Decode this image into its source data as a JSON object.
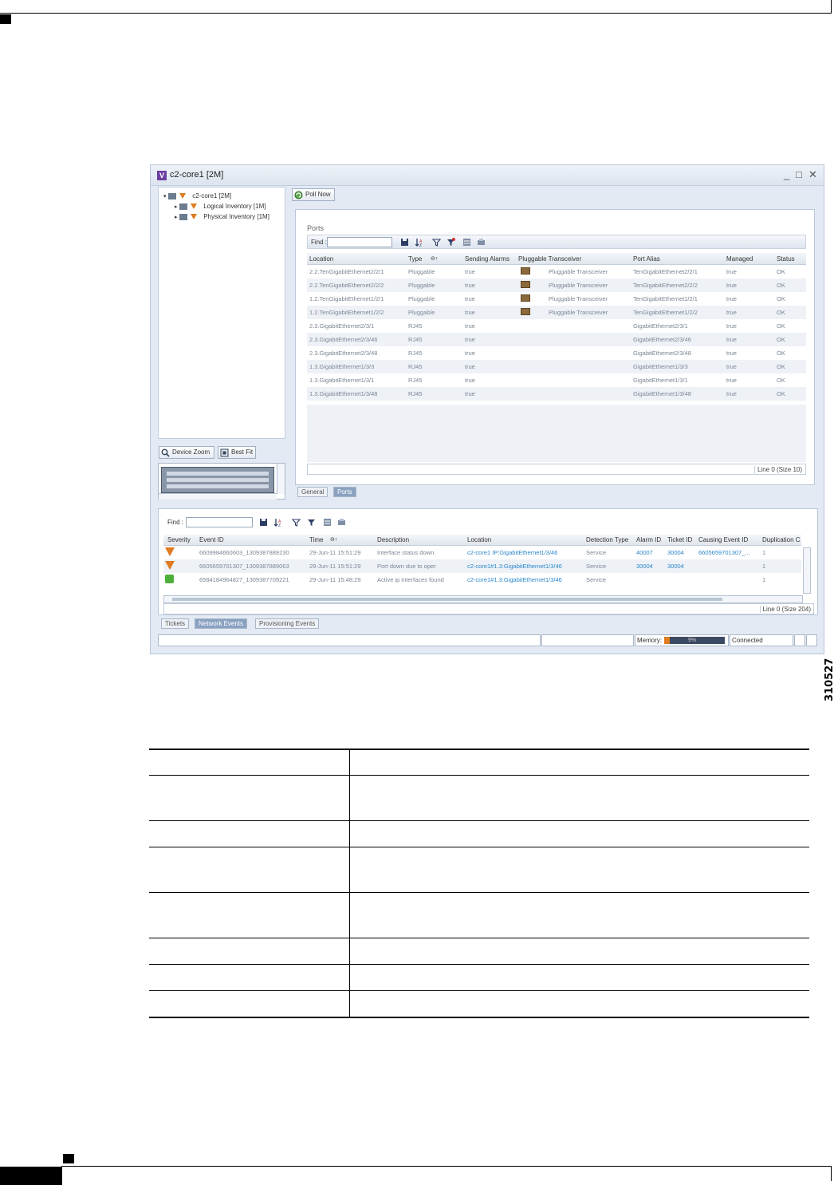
{
  "figure": {
    "id": "310527"
  },
  "window": {
    "title": "c2-core1 [2M]",
    "app_icon": "V",
    "controls": [
      "_",
      "□",
      "✕"
    ]
  },
  "tree": {
    "root": "c2-core1 [2M]",
    "children": [
      "Logical Inventory [1M]",
      "Physical Inventory [1M]"
    ]
  },
  "zoom": {
    "device_zoom_label": "Device Zoom",
    "best_fit_label": "Best Fit"
  },
  "poll_now_label": "Poll Now",
  "ports": {
    "title": "Ports",
    "find_label": "Find :",
    "find_value": "",
    "columns": [
      "Location",
      "Type",
      "Sending Alarms",
      "Pluggable Transceiver",
      "Port Alias",
      "Managed",
      "Status"
    ],
    "rows": [
      {
        "location": "2.2.TenGigabitEthernet2/2/1",
        "type": "Pluggable",
        "sending": "true",
        "pluggable": "Pluggable Transceiver",
        "alias": "TenGigabitEthernet2/2/1",
        "managed": "true",
        "status": "OK"
      },
      {
        "location": "2.2.TenGigabitEthernet2/2/2",
        "type": "Pluggable",
        "sending": "true",
        "pluggable": "Pluggable Transceiver",
        "alias": "TenGigabitEthernet2/2/2",
        "managed": "true",
        "status": "OK"
      },
      {
        "location": "1.2.TenGigabitEthernet1/2/1",
        "type": "Pluggable",
        "sending": "true",
        "pluggable": "Pluggable Transceiver",
        "alias": "TenGigabitEthernet1/2/1",
        "managed": "true",
        "status": "OK"
      },
      {
        "location": "1.2.TenGigabitEthernet1/2/2",
        "type": "Pluggable",
        "sending": "true",
        "pluggable": "Pluggable Transceiver",
        "alias": "TenGigabitEthernet1/2/2",
        "managed": "true",
        "status": "OK"
      },
      {
        "location": "2.3.GigabitEthernet2/3/1",
        "type": "RJ45",
        "sending": "true",
        "pluggable": "",
        "alias": "GigabitEthernet2/3/1",
        "managed": "true",
        "status": "OK"
      },
      {
        "location": "2.3.GigabitEthernet2/3/46",
        "type": "RJ45",
        "sending": "true",
        "pluggable": "",
        "alias": "GigabitEthernet2/3/46",
        "managed": "true",
        "status": "OK"
      },
      {
        "location": "2.3.GigabitEthernet2/3/48",
        "type": "RJ45",
        "sending": "true",
        "pluggable": "",
        "alias": "GigabitEthernet2/3/48",
        "managed": "true",
        "status": "OK"
      },
      {
        "location": "1.3.GigabitEthernet1/3/3",
        "type": "RJ45",
        "sending": "true",
        "pluggable": "",
        "alias": "GigabitEthernet1/3/3",
        "managed": "true",
        "status": "OK"
      },
      {
        "location": "1.3.GigabitEthernet1/3/1",
        "type": "RJ45",
        "sending": "true",
        "pluggable": "",
        "alias": "GigabitEthernet1/3/1",
        "managed": "true",
        "status": "OK"
      },
      {
        "location": "1.3.GigabitEthernet1/3/48",
        "type": "RJ45",
        "sending": "true",
        "pluggable": "",
        "alias": "GigabitEthernet1/3/48",
        "managed": "true",
        "status": "OK"
      }
    ],
    "line_status": "Line 0 (Size 10)",
    "tabs": [
      "General",
      "Ports"
    ],
    "active_tab": "Ports"
  },
  "events": {
    "find_label": "Find :",
    "find_value": "",
    "columns": [
      "Severity",
      "Event ID",
      "Time",
      "Description",
      "Location",
      "Detection Type",
      "Alarm ID",
      "Ticket ID",
      "Causing Event ID",
      "Duplication C"
    ],
    "rows": [
      {
        "severity": "critical",
        "event_id": "6609984660603_1309387889230",
        "time": "29-Jun-11 15:51:29",
        "description": "Interface status down",
        "location": "c2-core1 IP:GigabitEthernet1/3/46",
        "detection": "Service",
        "alarm_id": "40007",
        "ticket_id": "30004",
        "causing": "6605659701307_...",
        "dup": "1"
      },
      {
        "severity": "critical",
        "event_id": "6605659701307_1309387889063",
        "time": "29-Jun-11 15:51:29",
        "description": "Port down due to oper",
        "location": "c2-core1#1.3:GigabitEthernet1/3/46",
        "detection": "Service",
        "alarm_id": "30004",
        "ticket_id": "30004",
        "causing": "",
        "dup": "1"
      },
      {
        "severity": "cleared",
        "event_id": "6584184964827_1309387709221",
        "time": "29-Jun-11 15:48:29",
        "description": "Active ip interfaces found",
        "location": "c2-core1#1.3:GigabitEthernet1/3/46",
        "detection": "Service",
        "alarm_id": "",
        "ticket_id": "",
        "causing": "",
        "dup": "1"
      }
    ],
    "line_status": "Line 0 (Size 204)",
    "tabs": [
      "Tickets",
      "Network Events",
      "Provisioning Events"
    ],
    "active_tab": "Network Events"
  },
  "statusbar": {
    "memory_label": "Memory:",
    "memory_percent": 9,
    "memory_text": "9%",
    "connection": "Connected"
  },
  "colors": {
    "accent": "#2a86c9",
    "critical": "#e07b20",
    "cleared": "#4caf3a",
    "window_bg": "#e3eaf4"
  }
}
